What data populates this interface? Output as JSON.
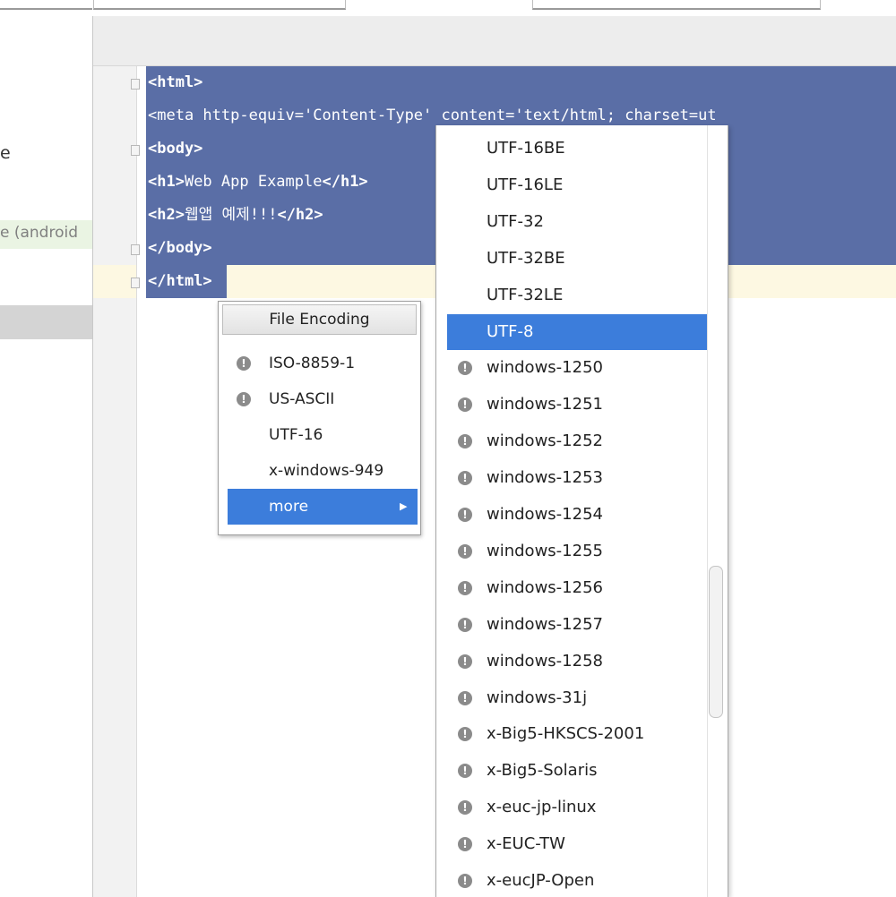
{
  "left_panel": {
    "fragment_1": "e",
    "fragment_2": "e (android"
  },
  "editor": {
    "lines": [
      {
        "pre": "",
        "tag_open": "<html>",
        "text": "",
        "tag_close": ""
      },
      {
        "pre": "<meta http-equiv='Content-Type' content='text/html; charset=ut",
        "tag_open": "",
        "text": "",
        "tag_close": ""
      },
      {
        "pre": "",
        "tag_open": "<body>",
        "text": "",
        "tag_close": ""
      },
      {
        "pre": "",
        "tag_open": "<h1>",
        "text": "Web App Example",
        "tag_close": "</h1>"
      },
      {
        "pre": "",
        "tag_open": "<h2>",
        "text": "웹앱 예제!!!",
        "tag_close": "</h2>"
      },
      {
        "pre": "",
        "tag_open": "</body>",
        "text": "",
        "tag_close": ""
      },
      {
        "pre": "",
        "tag_open": "</html>",
        "text": "",
        "tag_close": ""
      }
    ]
  },
  "file_encoding_menu": {
    "title": "File Encoding",
    "items": [
      {
        "label": "ISO-8859-1",
        "warning": true
      },
      {
        "label": "US-ASCII",
        "warning": true
      },
      {
        "label": "UTF-16",
        "warning": false
      },
      {
        "label": "x-windows-949",
        "warning": false
      }
    ],
    "more_label": "more",
    "more_arrow": "▶",
    "highlight_color": "#3c7ddb"
  },
  "encoding_submenu": {
    "selected": "UTF-8",
    "items": [
      {
        "label": "UTF-16BE",
        "warning": false
      },
      {
        "label": "UTF-16LE",
        "warning": false
      },
      {
        "label": "UTF-32",
        "warning": false
      },
      {
        "label": "UTF-32BE",
        "warning": false
      },
      {
        "label": "UTF-32LE",
        "warning": false
      },
      {
        "label": "UTF-8",
        "warning": false
      },
      {
        "label": "windows-1250",
        "warning": true
      },
      {
        "label": "windows-1251",
        "warning": true
      },
      {
        "label": "windows-1252",
        "warning": true
      },
      {
        "label": "windows-1253",
        "warning": true
      },
      {
        "label": "windows-1254",
        "warning": true
      },
      {
        "label": "windows-1255",
        "warning": true
      },
      {
        "label": "windows-1256",
        "warning": true
      },
      {
        "label": "windows-1257",
        "warning": true
      },
      {
        "label": "windows-1258",
        "warning": true
      },
      {
        "label": "windows-31j",
        "warning": true
      },
      {
        "label": "x-Big5-HKSCS-2001",
        "warning": true
      },
      {
        "label": "x-Big5-Solaris",
        "warning": true
      },
      {
        "label": "x-euc-jp-linux",
        "warning": true
      },
      {
        "label": "x-EUC-TW",
        "warning": true
      },
      {
        "label": "x-eucJP-Open",
        "warning": true
      }
    ]
  },
  "icons": {
    "warning_glyph": "!"
  },
  "colors": {
    "selection_bg": "#5a6ea6",
    "current_line_bg": "#fdf8e2"
  }
}
